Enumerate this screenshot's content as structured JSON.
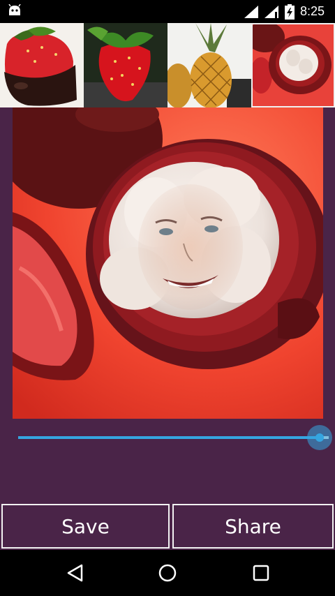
{
  "status_bar": {
    "time": "8:25",
    "icons": [
      "android-debug-icon",
      "wifi-icon",
      "signal-icon",
      "battery-charging-icon"
    ]
  },
  "thumbnails": [
    {
      "name": "chocolate-strawberry",
      "selected": false
    },
    {
      "name": "strawberry",
      "selected": false
    },
    {
      "name": "pineapple",
      "selected": false
    },
    {
      "name": "mangosteen",
      "selected": true
    }
  ],
  "preview": {
    "subject": "mangosteen-face"
  },
  "slider": {
    "value": 0.97
  },
  "buttons": {
    "save": "Save",
    "share": "Share"
  },
  "nav": {
    "icons": [
      "back-icon",
      "home-icon",
      "recents-icon"
    ]
  },
  "colors": {
    "background": "#4a2448",
    "accent": "#35a5e0"
  }
}
